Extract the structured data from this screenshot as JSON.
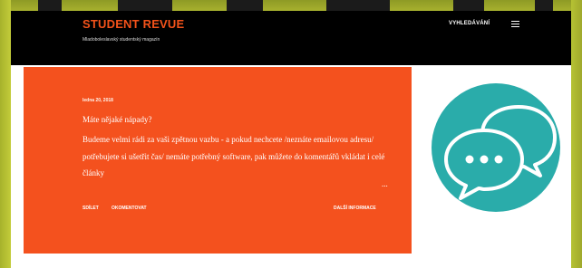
{
  "site": {
    "title": "STUDENT REVUE",
    "description": "Mladoboleslavský studentský magazín"
  },
  "header": {
    "search_label": "VYHLEDÁVÁNÍ",
    "menu_icon": "hamburger-menu-icon"
  },
  "post": {
    "date": "ledna 20, 2018",
    "title": "Máte nějaké nápady?",
    "snippet": "Budeme velmi rádi za vaši zpětnou vazbu - a pokud nechcete /neznáte emailovou adresu/ potřebujete si ušetřit čas/ nemáte potřebný software, pak můžete do komentářů vkládat i celé články",
    "ellipsis": "...",
    "share_label": "SDÍLET",
    "comment_label": "OKOMENTOVAT",
    "more_label": "DALŠÍ INFORMACE"
  },
  "sidebar": {
    "image_icon": "speech-bubbles-icon"
  },
  "colors": {
    "accent": "#f4511e",
    "header_bg": "#000000",
    "page_bg": "#ffffff",
    "frame": "#9aa52a",
    "teal_circle": "#2aacaa"
  }
}
